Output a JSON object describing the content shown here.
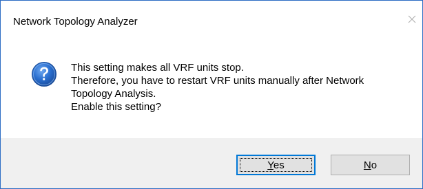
{
  "window": {
    "title": "Network Topology Analyzer",
    "close_icon": "close-icon"
  },
  "message": {
    "icon": "question-icon",
    "lines": [
      "This setting makes all VRF units stop.",
      "Therefore, you have to restart VRF units manually after Network",
      "Topology Analysis.",
      "Enable this setting?"
    ]
  },
  "buttons": {
    "yes": {
      "mnemonic": "Y",
      "rest": "es"
    },
    "no": {
      "mnemonic": "N",
      "rest": "o"
    }
  },
  "colors": {
    "window_border": "#2b6cc4",
    "footer_bg": "#f0f0f0",
    "icon_blue": "#1e5fbf",
    "default_button_border": "#0078d7"
  }
}
